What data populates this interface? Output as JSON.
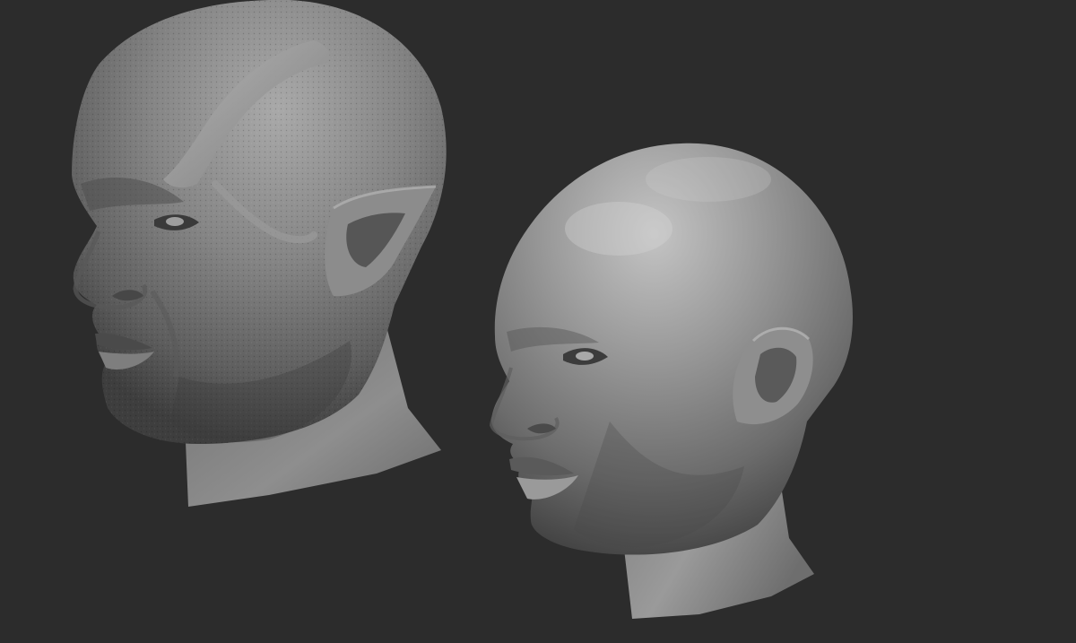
{
  "canvas": {
    "background_color": "#2c2c2c"
  },
  "scene": {
    "objects": [
      {
        "name": "textured-male-head",
        "kind": "sculpt",
        "has_pointed_ear": true,
        "has_forehead_ridge": true,
        "surface": "pore-detailed"
      },
      {
        "name": "smooth-female-head",
        "kind": "sculpt",
        "surface": "smooth"
      }
    ],
    "material_color": "#8a8a8a"
  }
}
